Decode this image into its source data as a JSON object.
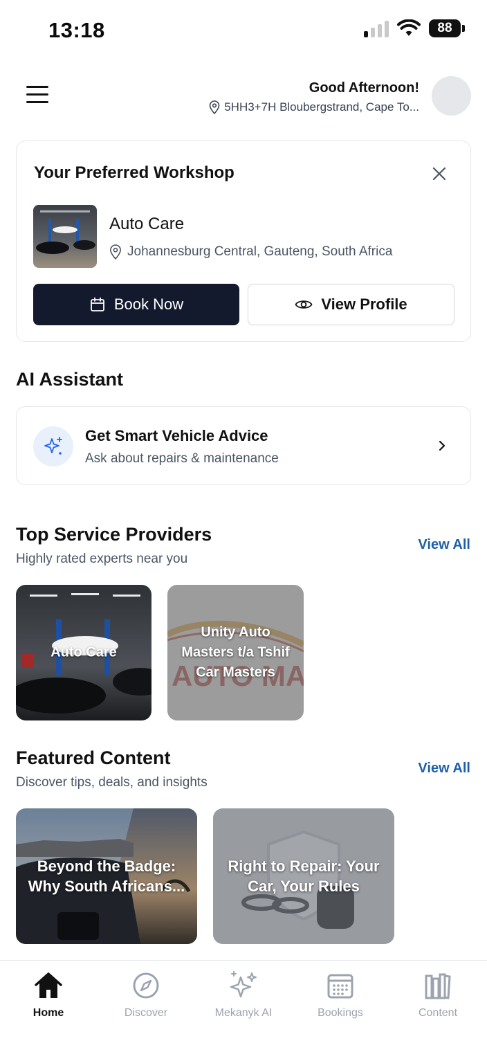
{
  "status_bar": {
    "time": "13:18",
    "battery": "88"
  },
  "header": {
    "greeting": "Good Afternoon!",
    "location": "5HH3+7H Bloubergstrand, Cape To..."
  },
  "workshop": {
    "title": "Your Preferred Workshop",
    "name": "Auto Care",
    "location": "Johannesburg Central, Gauteng, South Africa",
    "book_label": "Book Now",
    "profile_label": "View Profile"
  },
  "ai": {
    "section_title": "AI Assistant",
    "card_title": "Get Smart Vehicle Advice",
    "card_sub": "Ask about repairs & maintenance"
  },
  "providers": {
    "title": "Top Service Providers",
    "subtitle": "Highly rated experts near you",
    "view_all": "View All",
    "items": [
      {
        "name": "Auto Care"
      },
      {
        "name": "Unity Auto Masters t/a Tshif Car Masters"
      }
    ]
  },
  "featured": {
    "title": "Featured Content",
    "subtitle": "Discover tips, deals, and insights",
    "view_all": "View All",
    "items": [
      {
        "title": "Beyond the Badge: Why South Africans..."
      },
      {
        "title": "Right to Repair: Your Car, Your Rules"
      }
    ]
  },
  "nav": {
    "items": [
      {
        "label": "Home",
        "icon": "home-icon"
      },
      {
        "label": "Discover",
        "icon": "compass-icon"
      },
      {
        "label": "Mekanyk AI",
        "icon": "sparkles-icon"
      },
      {
        "label": "Bookings",
        "icon": "calendar-icon"
      },
      {
        "label": "Content",
        "icon": "books-icon"
      }
    ]
  },
  "colors": {
    "primary_dark": "#131a2e",
    "link_blue": "#1d5fa8",
    "ai_bg": "#e8f0fb"
  }
}
